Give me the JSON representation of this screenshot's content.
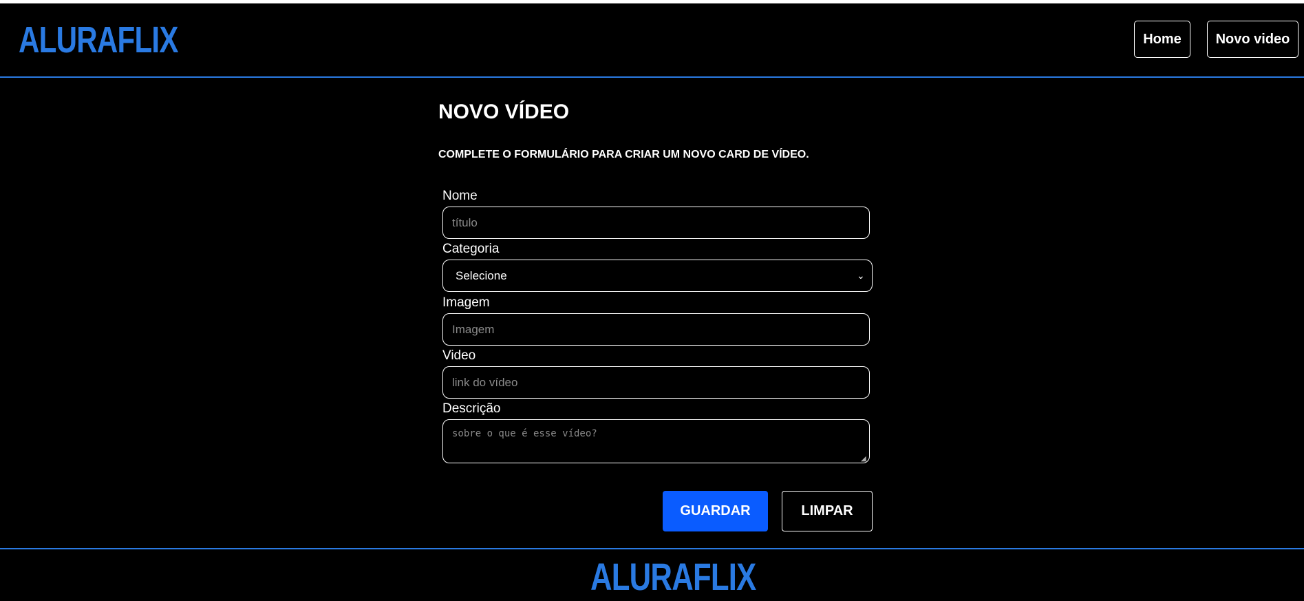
{
  "header": {
    "logo": "ALURAFLIX",
    "nav": [
      {
        "label": "Home"
      },
      {
        "label": "Novo video"
      }
    ]
  },
  "form": {
    "title": "NOVO VÍDEO",
    "subtitle": "COMPLETE O FORMULÁRIO PARA CRIAR UM NOVO CARD DE VÍDEO.",
    "fields": {
      "nome": {
        "label": "Nome",
        "placeholder": "título",
        "value": ""
      },
      "categoria": {
        "label": "Categoria",
        "selected": "Selecione"
      },
      "imagem": {
        "label": "Imagem",
        "placeholder": "Imagem",
        "value": ""
      },
      "video": {
        "label": "Video",
        "placeholder": "link do vídeo",
        "value": ""
      },
      "descricao": {
        "label": "Descrição",
        "placeholder": "sobre o que é esse vídeo?",
        "value": ""
      }
    },
    "buttons": {
      "guardar": "GUARDAR",
      "limpar": "LIMPAR"
    }
  },
  "footer": {
    "logo": "ALURAFLIX"
  },
  "colors": {
    "accent": "#2a7ae2",
    "primary_button": "#0a5cff",
    "background": "#000000",
    "text": "#ffffff"
  },
  "icons": {
    "select_chevron": "chevron-down-icon",
    "textarea_resize": "resize-handle-icon"
  }
}
